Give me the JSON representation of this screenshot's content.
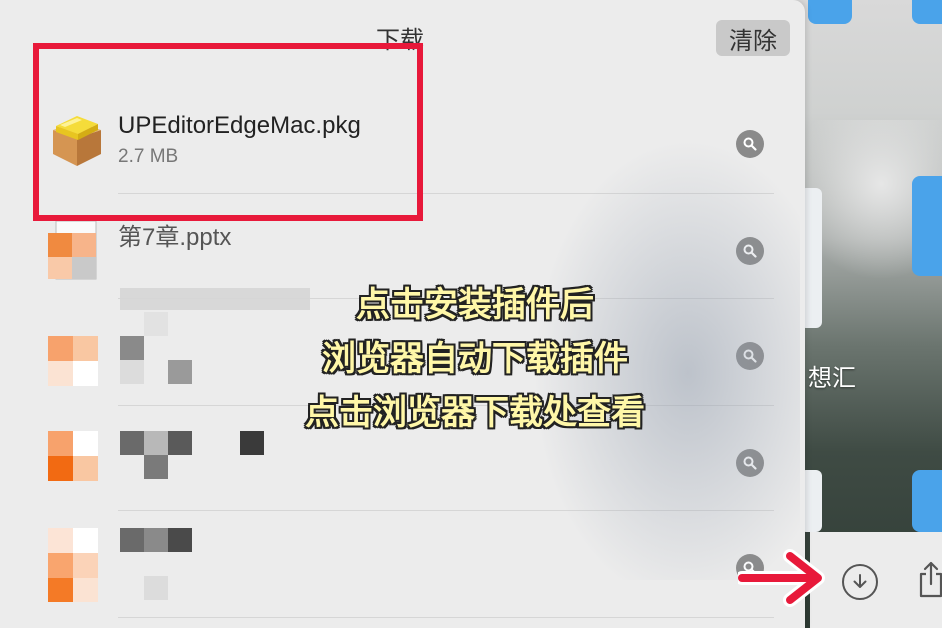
{
  "panel": {
    "title": "下载",
    "clear_label": "清除"
  },
  "downloads": [
    {
      "name": "UPEditorEdgeMac.pkg",
      "size": "2.7 MB",
      "icon": "package-icon"
    },
    {
      "name": "第7章.pptx",
      "size": "",
      "icon": "document-icon"
    },
    {
      "name": "",
      "size": "",
      "icon": "blurred-file-icon"
    },
    {
      "name": "",
      "size": "",
      "icon": "blurred-file-icon"
    },
    {
      "name": "",
      "size": "",
      "icon": "blurred-file-icon"
    }
  ],
  "caption": {
    "line1": "点击安装插件后",
    "line2": "浏览器自动下载插件",
    "line3": "点击浏览器下载处查看"
  },
  "desktop": {
    "folder_label": "想汇"
  },
  "colors": {
    "highlight": "#e8193a",
    "caption_text": "#fff7a8",
    "folder_blue": "#4aa3ea"
  }
}
